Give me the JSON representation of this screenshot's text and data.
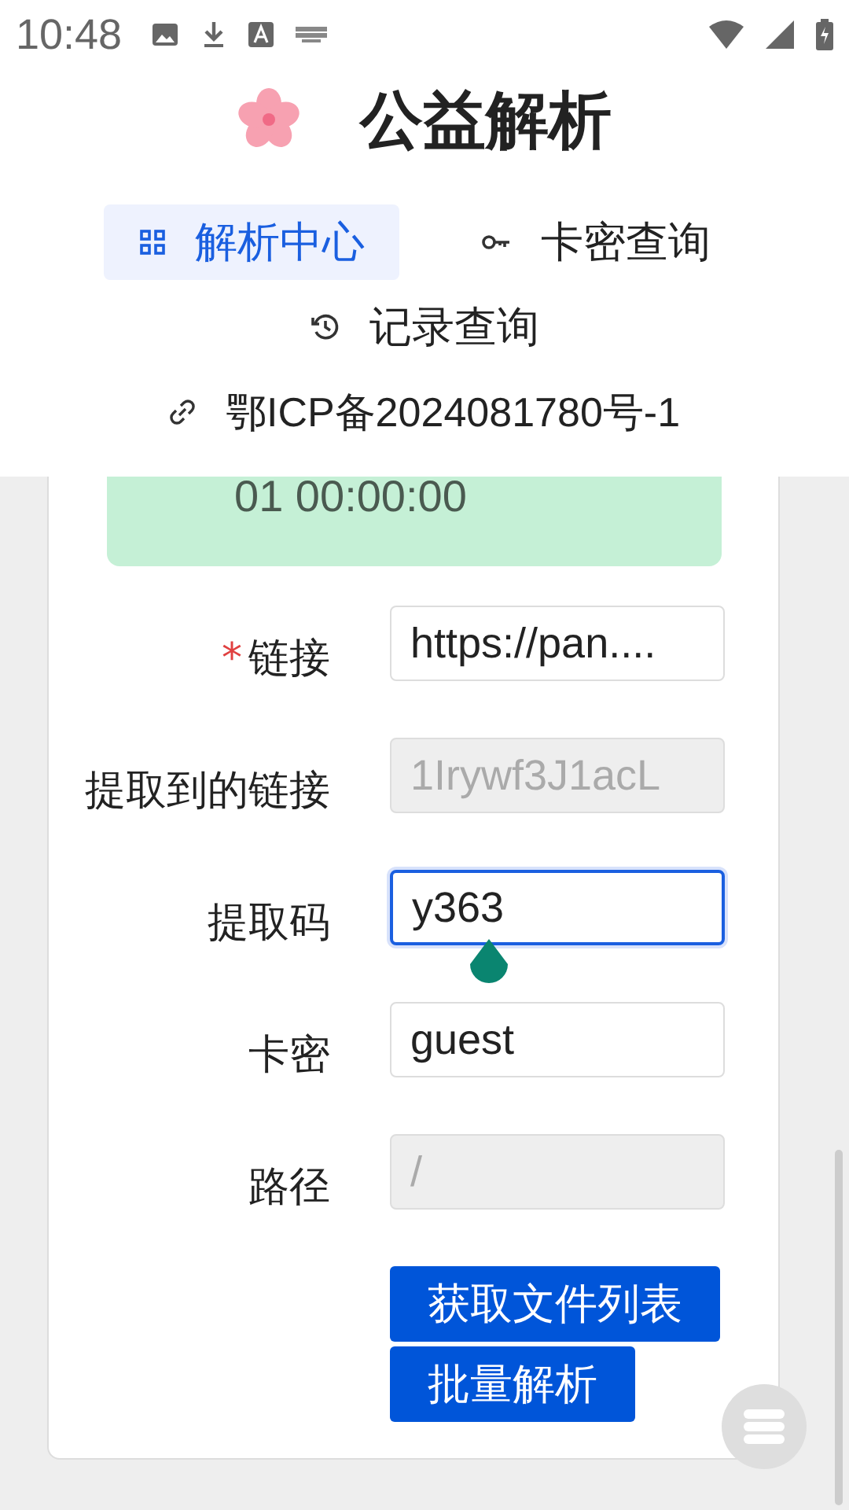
{
  "status_bar": {
    "time": "10:48"
  },
  "header": {
    "title": "公益解析"
  },
  "nav": [
    {
      "label": "解析中心",
      "selected": true
    },
    {
      "label": "卡密查询",
      "selected": false
    },
    {
      "label": "记录查询",
      "selected": false
    }
  ],
  "icp_link": "鄂ICP备2024081780号-1",
  "notice": {
    "text": "01 00:00:00"
  },
  "form": [
    {
      "label": "链接",
      "required_mark": "*",
      "value": "https://pan....",
      "disabled": false,
      "focused": false
    },
    {
      "label": "提取到的链接",
      "value": "1Irywf3J1acL",
      "disabled": true,
      "focused": false
    },
    {
      "label": "提取码",
      "value": "y363",
      "disabled": false,
      "focused": true
    },
    {
      "label": "卡密",
      "value": "guest",
      "disabled": false,
      "focused": false
    },
    {
      "label": "路径",
      "value": "/",
      "disabled": true,
      "focused": false
    }
  ],
  "buttons": [
    "获取文件列表",
    "批量解析"
  ]
}
